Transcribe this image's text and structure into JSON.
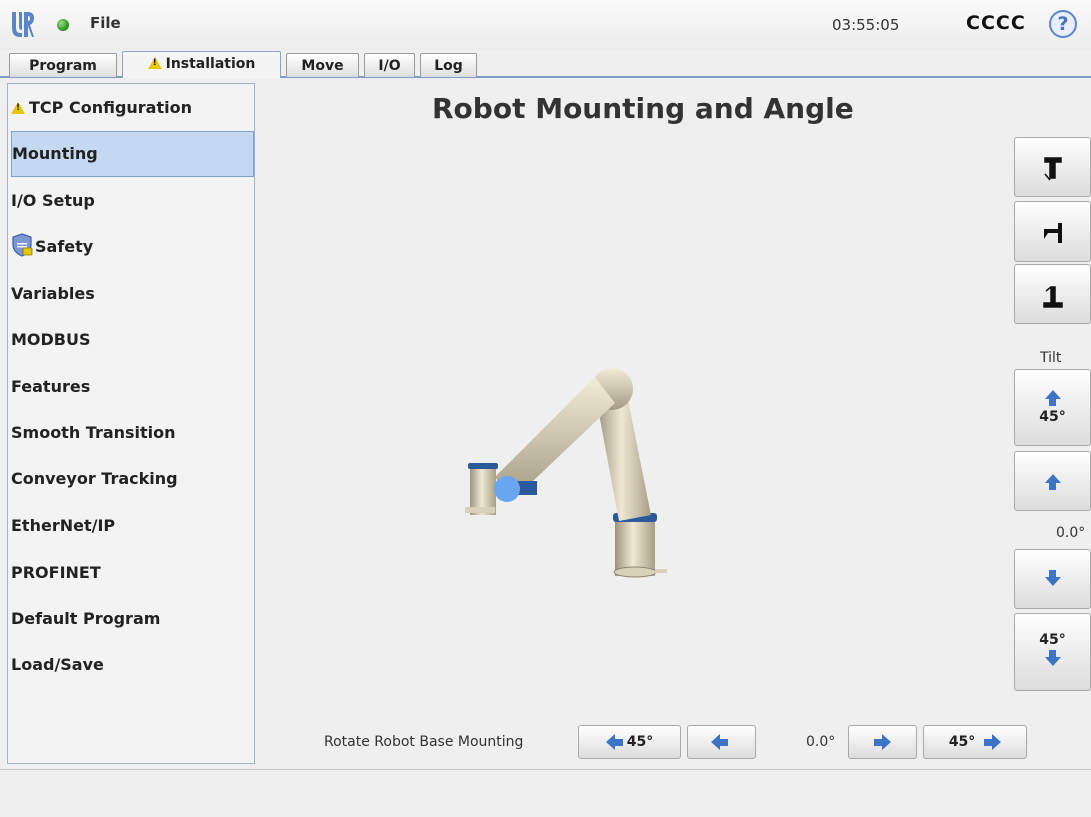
{
  "header": {
    "file_label": "File",
    "time": "03:55:05",
    "robot_name": "CCCC",
    "help_label": "?",
    "status_color": "#2f9a1f"
  },
  "tabs": [
    {
      "label": "Program",
      "active": false
    },
    {
      "label": "Installation",
      "active": true,
      "warning": true
    },
    {
      "label": "Move",
      "active": false
    },
    {
      "label": "I/O",
      "active": false
    },
    {
      "label": "Log",
      "active": false
    }
  ],
  "sidebar": {
    "items": [
      {
        "label": "TCP Configuration",
        "icon": "warning-icon",
        "selected": false
      },
      {
        "label": "Mounting",
        "selected": true
      },
      {
        "label": "I/O Setup",
        "selected": false
      },
      {
        "label": "Safety",
        "icon": "safety-shield-icon",
        "selected": false
      },
      {
        "label": "Variables",
        "selected": false
      },
      {
        "label": "MODBUS",
        "selected": false
      },
      {
        "label": "Features",
        "selected": false
      },
      {
        "label": "Smooth Transition",
        "selected": false
      },
      {
        "label": "Conveyor Tracking",
        "selected": false
      },
      {
        "label": "EtherNet/IP",
        "selected": false
      },
      {
        "label": "PROFINET",
        "selected": false
      },
      {
        "label": "Default Program",
        "selected": false
      },
      {
        "label": "Load/Save",
        "selected": false
      }
    ]
  },
  "main": {
    "title": "Robot Mounting and Angle",
    "tilt_label": "Tilt",
    "tilt_up45_label": "45°",
    "tilt_value": "0.0°",
    "tilt_down45_label": "45°",
    "rotate_label": "Rotate Robot Base Mounting",
    "rotate_left45_label": "45°",
    "rotate_value": "0.0°",
    "rotate_right45_label": "45°"
  }
}
